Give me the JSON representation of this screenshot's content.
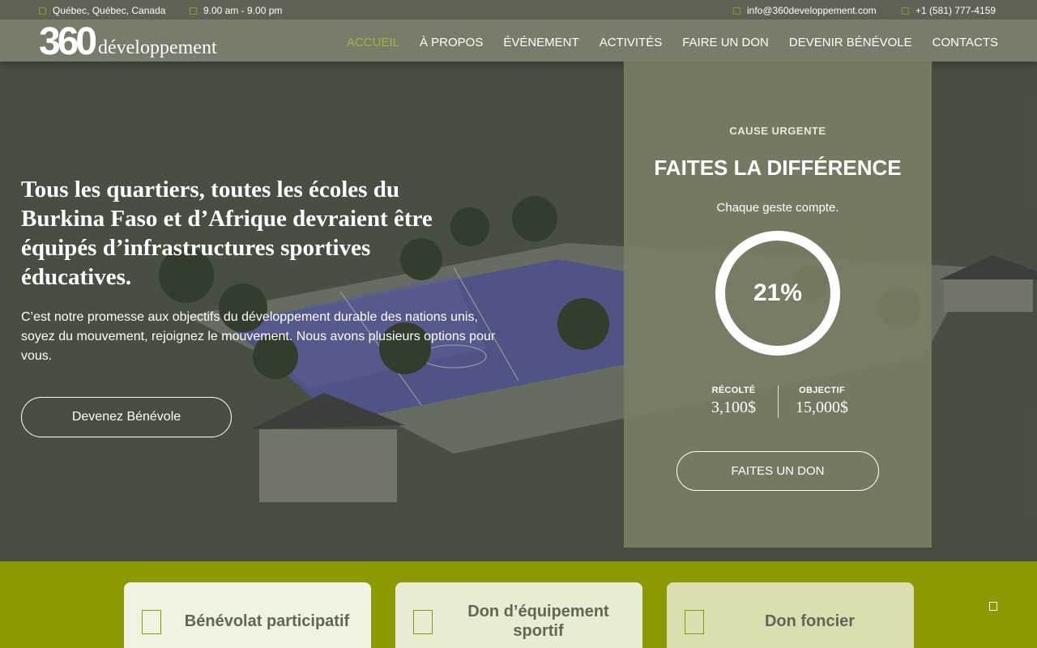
{
  "topbar": {
    "location": "Québec, Québec, Canada",
    "hours": "9.00 am - 9.00 pm",
    "email": "info@360developpement.com",
    "phone": "+1 (581) 777-4159",
    "icons": [
      "map-marker-icon",
      "clock-icon",
      "envelope-icon",
      "phone-icon"
    ]
  },
  "brand": {
    "number": "360",
    "word": "développement"
  },
  "nav": {
    "items": [
      "ACCUEIL",
      "À PROPOS",
      "ÉVÉNEMENT",
      "ACTIVITÉS",
      "FAIRE UN DON",
      "DEVENIR BÉNÉVOLE",
      "CONTACTS"
    ],
    "active_index": 0
  },
  "hero": {
    "headline": "Tous les quartiers, toutes les écoles du Burkina Faso et d’Afrique devraient être équipés d’infrastructures sportives éducatives.",
    "lead": "C’est notre promesse aux objectifs du développement durable des nations unis, soyez du mouvement, rejoignez le mouvement. Nous avons plusieurs options pour vous.",
    "cta": "Devenez Bénévole"
  },
  "cause": {
    "eyebrow": "CAUSE URGENTE",
    "title": "FAITES LA DIFFÉRENCE",
    "subtitle": "Chaque geste compte.",
    "percent_label": "21%",
    "progress": 0.21,
    "raised_label": "RÉCOLTÉ",
    "raised_value": "3,100$",
    "goal_label": "OBJECTIF",
    "goal_value": "15,000$",
    "cta": "FAITES UN DON"
  },
  "features": [
    {
      "label": "Bénévolat participatif"
    },
    {
      "label": "Don d’équipement sportif"
    },
    {
      "label": "Don foncier"
    }
  ],
  "colors": {
    "accent": "#8c9900",
    "nav_active": "#a8b33a"
  }
}
